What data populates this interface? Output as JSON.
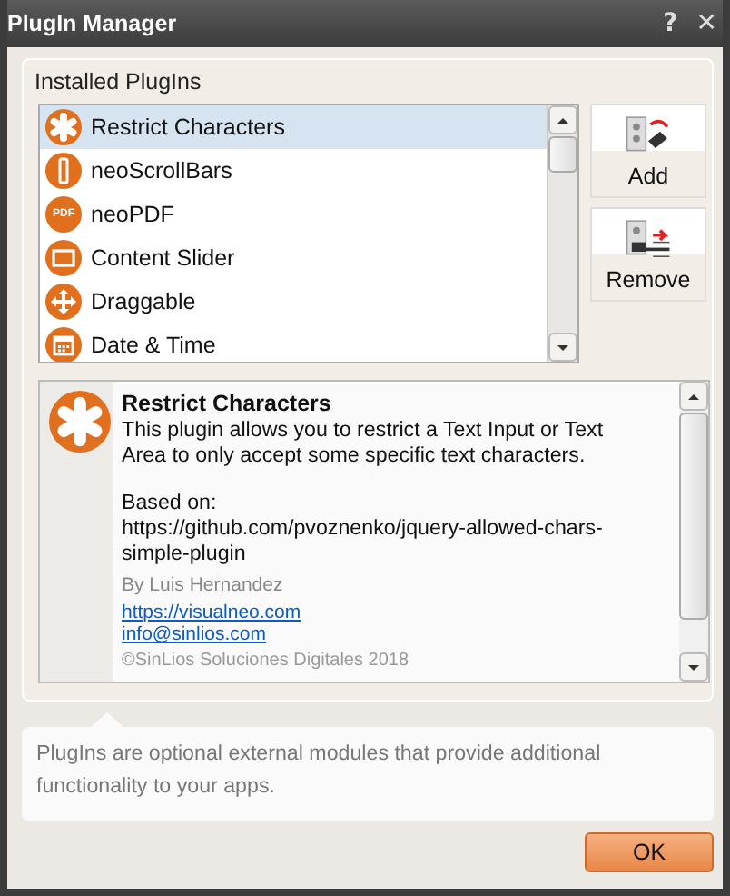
{
  "window": {
    "title": "PlugIn Manager",
    "help": "?",
    "close": "✕"
  },
  "group": {
    "label": "Installed PlugIns"
  },
  "plugins": [
    {
      "name": "Restrict Characters",
      "kind": "asterisk",
      "selected": true
    },
    {
      "name": "neoScrollBars",
      "kind": "bar",
      "selected": false
    },
    {
      "name": "neoPDF",
      "kind": "pdf",
      "icon_text": "PDF",
      "selected": false
    },
    {
      "name": "Content Slider",
      "kind": "slider",
      "selected": false
    },
    {
      "name": "Draggable",
      "kind": "move",
      "selected": false
    },
    {
      "name": "Date & Time",
      "kind": "calendar",
      "selected": false
    }
  ],
  "buttons": [
    {
      "label": "Add",
      "kind": "add"
    },
    {
      "label": "Remove",
      "kind": "remove"
    }
  ],
  "details": {
    "kind": "asterisk",
    "title": "Restrict Characters",
    "description": "This plugin allows you to restrict a Text Input or Text Area to only accept some specific text characters.",
    "based_on": "Based on:",
    "based_url": "https://github.com/pvoznenko/jquery-allowed-chars-simple-plugin",
    "author": "By Luis Hernandez",
    "links": [
      "https://visualneo.com",
      "info@sinlios.com"
    ],
    "copyright": "©SinLios Soluciones Digitales 2018"
  },
  "info": "PlugIns are optional external modules that provide additional functionality to your apps.",
  "ok": "OK"
}
